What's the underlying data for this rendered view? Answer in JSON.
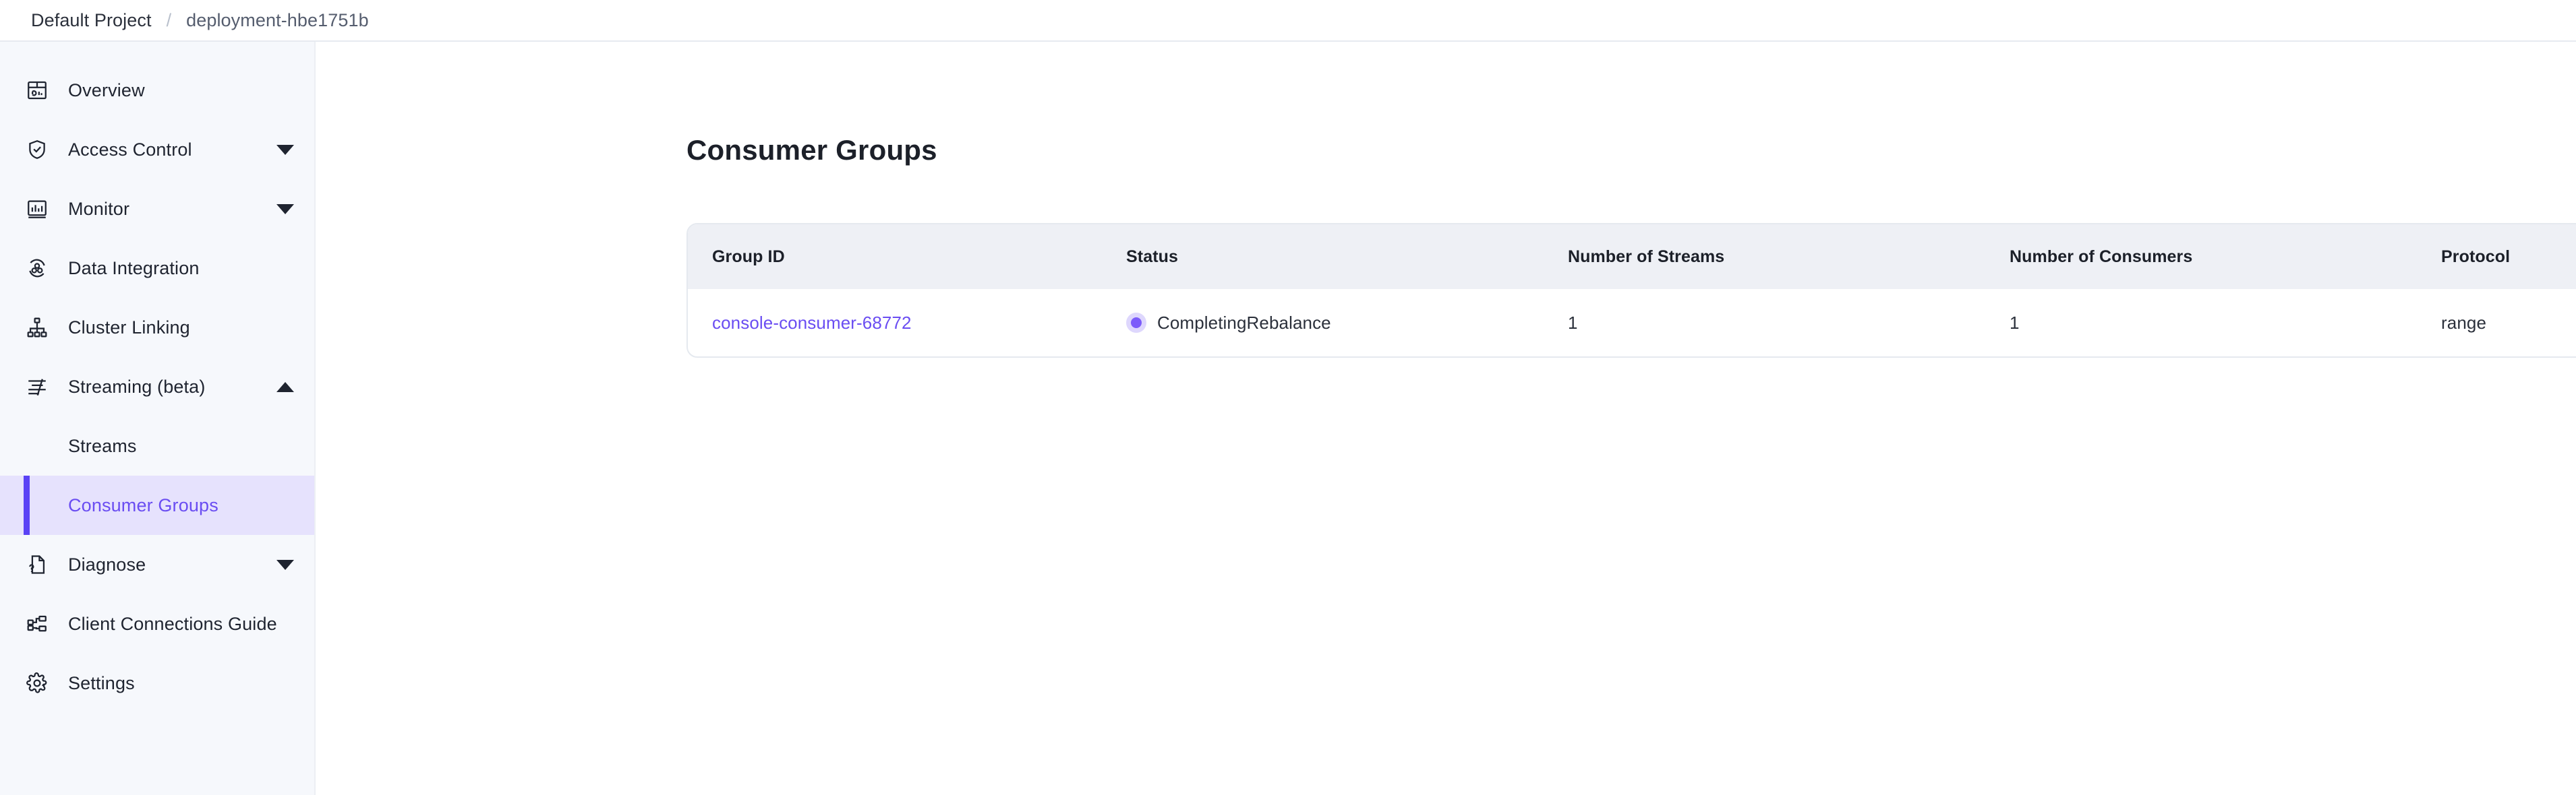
{
  "breadcrumb": {
    "project": "Default Project",
    "separator": "/",
    "deployment": "deployment-hbe1751b"
  },
  "sidebar": {
    "items": [
      {
        "label": "Overview",
        "icon": "dashboard-icon",
        "expandable": false,
        "id": "overview"
      },
      {
        "label": "Access Control",
        "icon": "shield-check-icon",
        "expandable": true,
        "state": "collapsed",
        "id": "access-control"
      },
      {
        "label": "Monitor",
        "icon": "bar-chart-icon",
        "expandable": true,
        "state": "collapsed",
        "id": "monitor"
      },
      {
        "label": "Data Integration",
        "icon": "data-integration-icon",
        "expandable": false,
        "id": "data-integration"
      },
      {
        "label": "Cluster Linking",
        "icon": "sitemap-icon",
        "expandable": false,
        "id": "cluster-linking"
      },
      {
        "label": "Streaming (beta)",
        "icon": "streaming-icon",
        "expandable": true,
        "state": "expanded",
        "id": "streaming"
      },
      {
        "label": "Diagnose",
        "icon": "document-question-icon",
        "expandable": true,
        "state": "collapsed",
        "id": "diagnose"
      },
      {
        "label": "Client Connections Guide",
        "icon": "network-nodes-icon",
        "expandable": false,
        "id": "client-connections-guide"
      },
      {
        "label": "Settings",
        "icon": "gear-icon",
        "expandable": false,
        "id": "settings"
      }
    ],
    "streaming_children": [
      {
        "label": "Streams",
        "active": false,
        "id": "streams"
      },
      {
        "label": "Consumer Groups",
        "active": true,
        "id": "consumer-groups"
      }
    ],
    "accent_color": "#5a42f5",
    "active_bg": "#e6e2fd",
    "active_text": "#6a4df2"
  },
  "main": {
    "page_title": "Consumer Groups",
    "table": {
      "columns": [
        "Group ID",
        "Status",
        "Number of Streams",
        "Number of Consumers",
        "Protocol"
      ],
      "rows": [
        {
          "group_id": "console-consumer-68772",
          "status": "CompletingRebalance",
          "status_color": "#7c5cfa",
          "number_of_streams": "1",
          "number_of_consumers": "1",
          "protocol": "range"
        }
      ]
    }
  }
}
